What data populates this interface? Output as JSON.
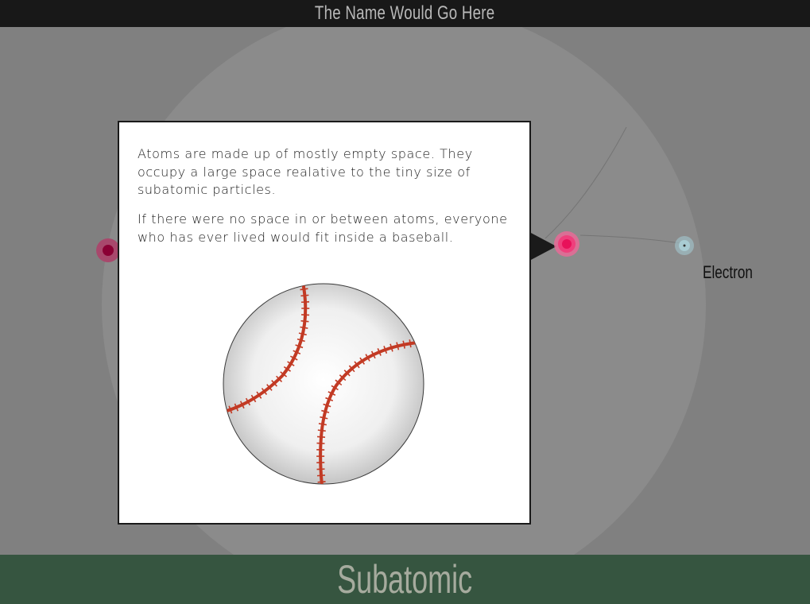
{
  "header": {
    "title": "The Name Would Go Here"
  },
  "diagram": {
    "electron_label": "Electron",
    "colors": {
      "proton": "#e8115a",
      "electron": "#8fb8c2",
      "orbit": "#8c8c8c"
    }
  },
  "popup": {
    "paragraph_1": "Atoms are made up of mostly empty space.  They occupy a large space realative to the tiny size of subatomic particles.",
    "paragraph_2": "If there were no space in or between atoms, everyone who has ever lived would fit inside a baseball.",
    "illustration": "baseball"
  },
  "footer": {
    "title": "Subatomic"
  }
}
